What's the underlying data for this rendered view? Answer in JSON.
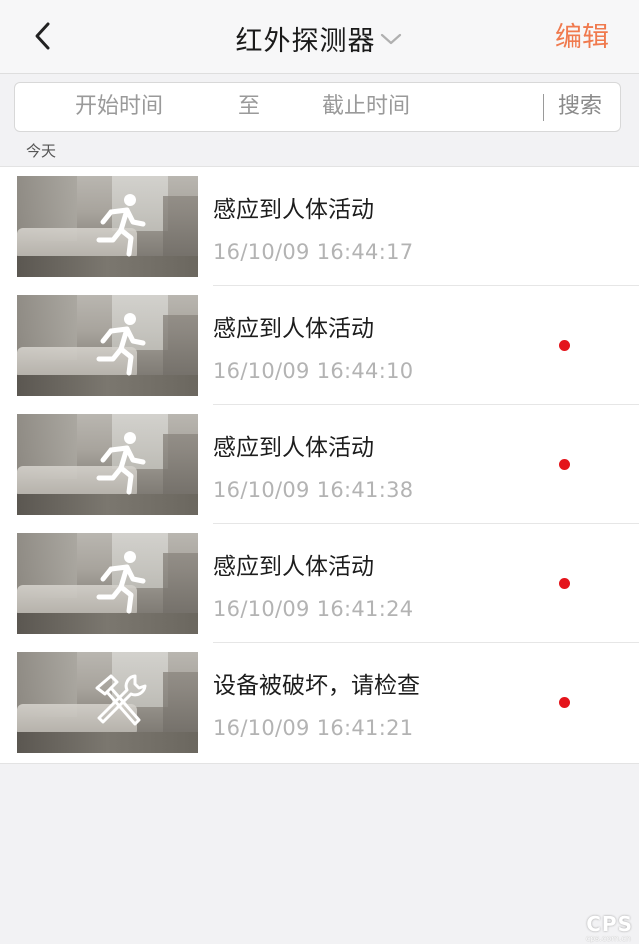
{
  "nav": {
    "back_icon": "chevron-left-icon",
    "title": "红外探测器",
    "title_dropdown_icon": "chevron-down-icon",
    "edit_label": "编辑"
  },
  "search": {
    "start_placeholder": "开始时间",
    "to_label": "至",
    "end_placeholder": "截止时间",
    "search_label": "搜索"
  },
  "section": {
    "label": "今天"
  },
  "events": [
    {
      "title": "感应到人体活动",
      "time": "16/10/09 16:44:17",
      "icon": "running-person-icon",
      "unread": false
    },
    {
      "title": "感应到人体活动",
      "time": "16/10/09 16:44:10",
      "icon": "running-person-icon",
      "unread": true
    },
    {
      "title": "感应到人体活动",
      "time": "16/10/09 16:41:38",
      "icon": "running-person-icon",
      "unread": true
    },
    {
      "title": "感应到人体活动",
      "time": "16/10/09 16:41:24",
      "icon": "running-person-icon",
      "unread": true
    },
    {
      "title": "设备被破坏，请检查",
      "time": "16/10/09 16:41:21",
      "icon": "hammer-wrench-icon",
      "unread": true
    }
  ],
  "colors": {
    "accent": "#f07a4e",
    "unread_dot": "#e4141b",
    "time_text": "#b3b3b3"
  },
  "watermark": {
    "main": "CPS",
    "sub": "cps.com.cn"
  }
}
